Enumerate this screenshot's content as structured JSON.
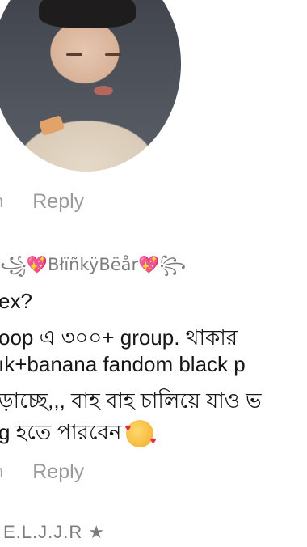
{
  "comment1": {
    "reply_dot": "h",
    "reply_label": "Reply"
  },
  "comment2": {
    "username_prefix": "꧁",
    "username_heart": "💖",
    "username": "BłïñkÿBëår",
    "username_suffix": "꧂",
    "lines": [
      "ex?",
      "oop এ ৩০০+ group. থাকার",
      "ık+banana fandom black p",
      "ড়াচ্ছে,,, বাহ বাহ চালিয়ে যাও ভ",
      "g হতে পারবেন"
    ],
    "emoji_name": "smiling-face-with-hearts-emoji",
    "reply_dot": "h",
    "reply_label": "Reply"
  },
  "comment3": {
    "username": "E.L.J.J.R ★"
  }
}
